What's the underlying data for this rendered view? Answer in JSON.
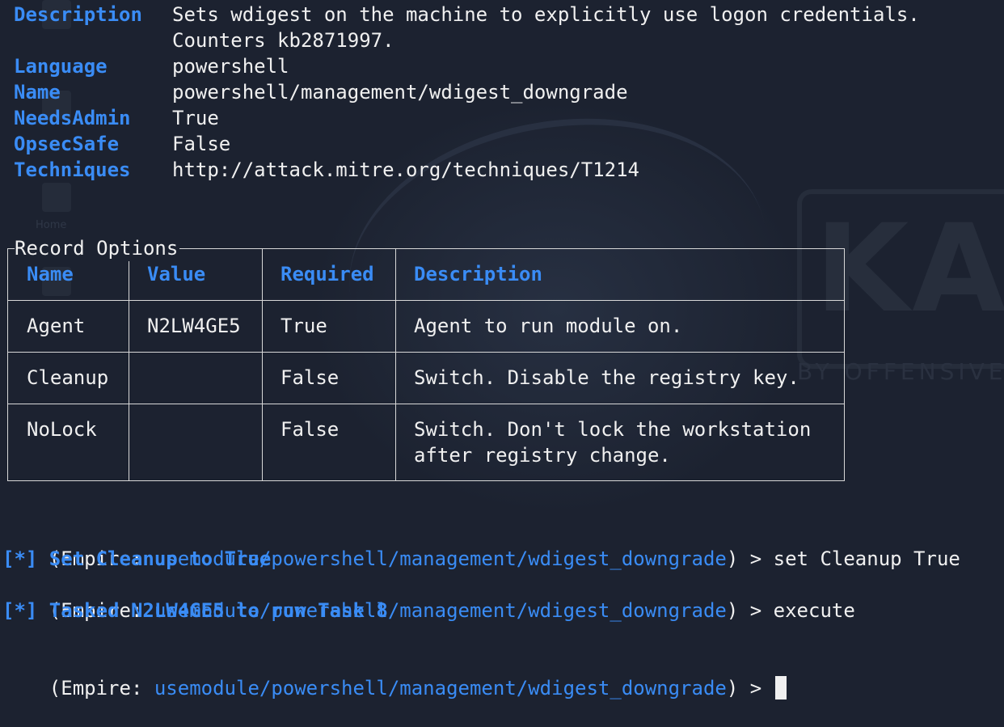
{
  "module_info": {
    "description_key": "Description",
    "description_line1": "Sets wdigest on the machine to explicitly use logon credentials.",
    "description_line2": "Counters kb2871997.",
    "language_key": "Language",
    "language_value": "powershell",
    "name_key": "Name",
    "name_value": "powershell/management/wdigest_downgrade",
    "needsadmin_key": "NeedsAdmin",
    "needsadmin_value": "True",
    "opsecsafe_key": "OpsecSafe",
    "opsecsafe_value": "False",
    "techniques_key": "Techniques",
    "techniques_value": "http://attack.mitre.org/techniques/T1214"
  },
  "options_table": {
    "title": "Record Options",
    "headers": [
      "Name",
      "Value",
      "Required",
      "Description"
    ],
    "rows": [
      {
        "name": "Agent",
        "value": "N2LW4GE5",
        "required": "True",
        "description": [
          "Agent to run module on."
        ]
      },
      {
        "name": "Cleanup",
        "value": "",
        "required": "False",
        "description": [
          "Switch. Disable the registry key."
        ]
      },
      {
        "name": "NoLock",
        "value": "",
        "required": "False",
        "description": [
          "Switch. Don't lock the workstation",
          "after registry change."
        ]
      }
    ]
  },
  "session": {
    "prompt_open": "(Empire: ",
    "prompt_module": "usemodule/powershell/management/wdigest_downgrade",
    "prompt_close": ") > ",
    "command1": "set Cleanup True",
    "notice1": "[*] Set Cleanup to True",
    "command2": "execute",
    "notice2": "[*] Tasked N2LW4GE5 to run Task 8",
    "command3": ""
  },
  "colors": {
    "background": "#1c2230",
    "accent_blue": "#3a8cf5",
    "text": "#f0f0f0",
    "table_border": "#d8d8d8"
  }
}
